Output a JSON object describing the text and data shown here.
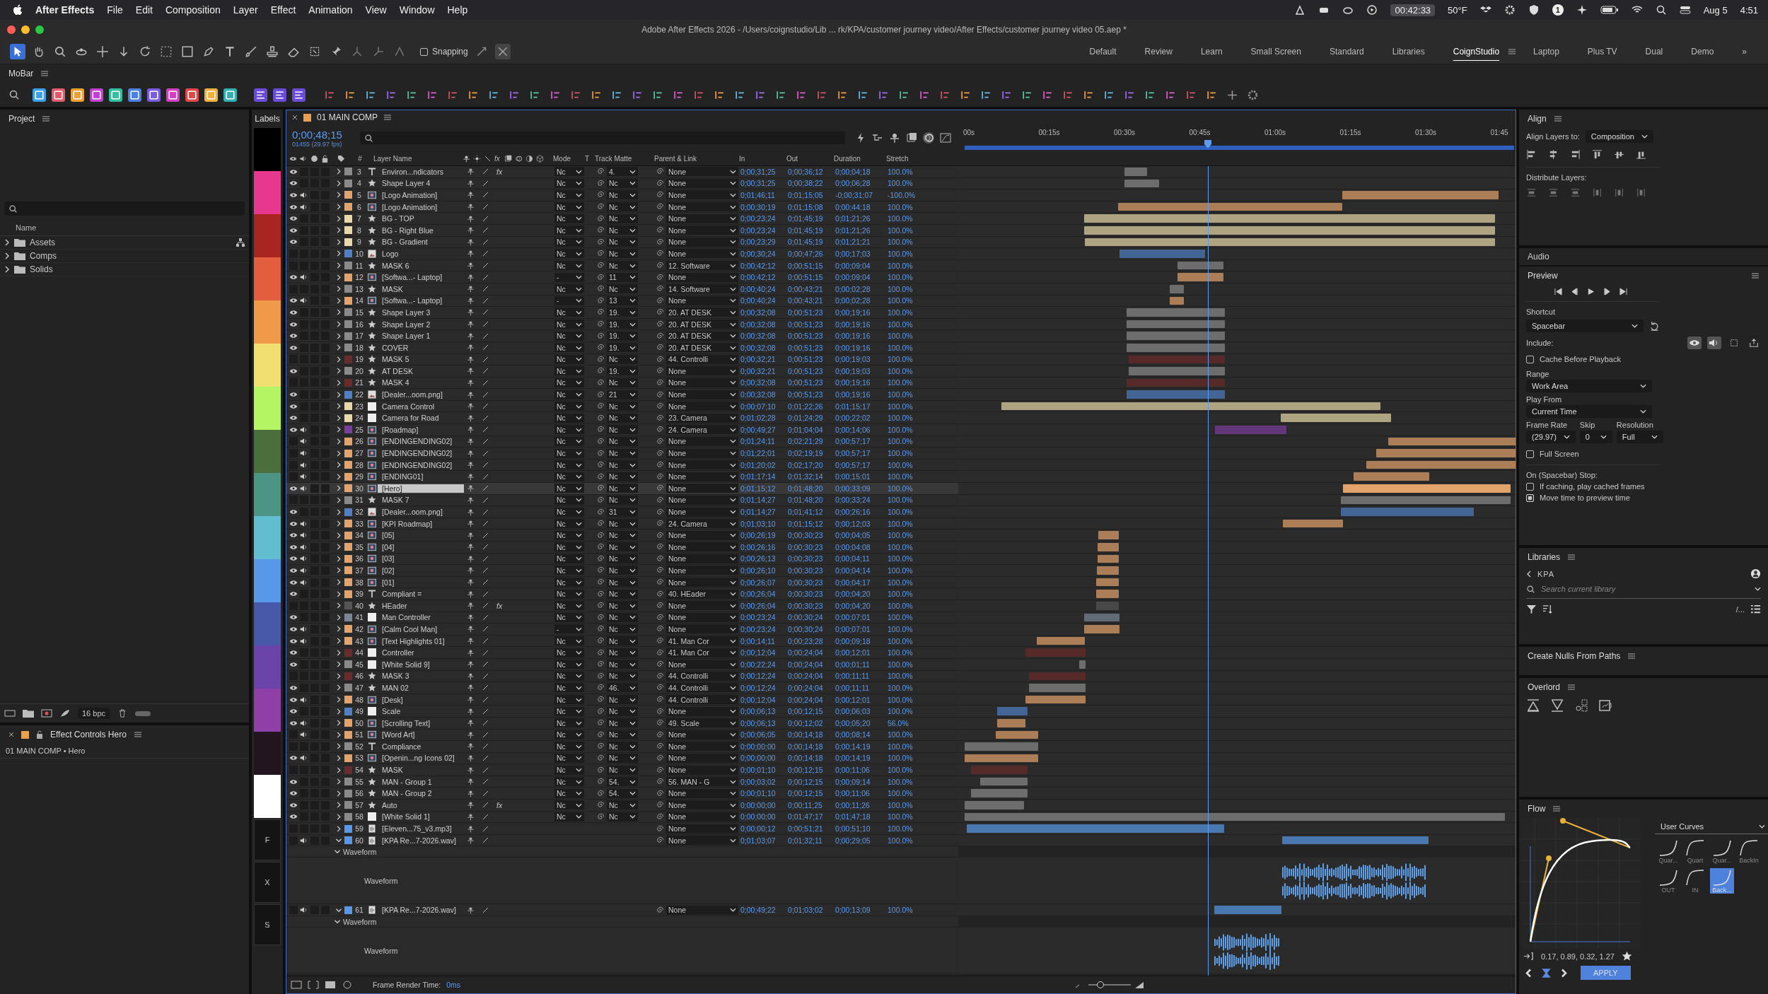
{
  "menubar": {
    "app": "After Effects",
    "items": [
      "File",
      "Edit",
      "Composition",
      "Layer",
      "Effect",
      "Animation",
      "View",
      "Window",
      "Help"
    ],
    "timer": "00:42:33",
    "weather": "50°F",
    "badge": "1",
    "date": "Aug 5",
    "clock": "4:51"
  },
  "window": {
    "title": "Adobe After Effects 2026 - /Users/coignstudio/Lib ... rk/KPA/customer journey video/After Effects/customer journey video 05.aep *"
  },
  "toolbar": {
    "snapping": {
      "label": "Snapping",
      "checked": false
    },
    "workspaces": [
      {
        "label": "Default",
        "selected": false
      },
      {
        "label": "Review",
        "selected": false
      },
      {
        "label": "Learn",
        "selected": false
      },
      {
        "label": "Small Screen",
        "selected": false
      },
      {
        "label": "Standard",
        "selected": false
      },
      {
        "label": "Libraries",
        "selected": false
      },
      {
        "label": "CoignStudio",
        "selected": true
      },
      {
        "label": "Laptop",
        "selected": false
      },
      {
        "label": "Plus TV",
        "selected": false
      },
      {
        "label": "Dual",
        "selected": false
      },
      {
        "label": "Demo",
        "selected": false
      }
    ],
    "more": "»"
  },
  "mobar": {
    "title": "MoBar"
  },
  "project": {
    "title": "Project",
    "column": "Name",
    "folders": [
      {
        "name": "Assets",
        "expanded": false
      },
      {
        "name": "Comps",
        "expanded": false
      },
      {
        "name": "Solids",
        "expanded": false
      }
    ],
    "depth": "16 bpc"
  },
  "effect_controls": {
    "title": "Effect Controls Hero",
    "path": "01 MAIN COMP • Hero"
  },
  "labels": {
    "title": "Labels",
    "swatches": [
      {
        "color": "#000000"
      },
      {
        "color": "#e8378e"
      },
      {
        "color": "#a8261f"
      },
      {
        "color": "#e25e3c"
      },
      {
        "color": "#ef9a48"
      },
      {
        "color": "#f1e06f"
      },
      {
        "color": "#b3f563"
      },
      {
        "color": "#4a6e3c"
      },
      {
        "color": "#4c9484"
      },
      {
        "color": "#63bdd0"
      },
      {
        "color": "#5798e8"
      },
      {
        "color": "#4759a8"
      },
      {
        "color": "#6a44a8"
      },
      {
        "color": "#8e40a8"
      },
      {
        "color": "#221520"
      },
      {
        "color": "#ffffff"
      }
    ],
    "buttons": [
      "F",
      "X",
      "S"
    ]
  },
  "comp": {
    "tab": "01 MAIN COMP",
    "time": "0;00;48;15",
    "frames": "01455 (29.97 fps)",
    "columns": {
      "fx": "fx",
      "num": "#",
      "name": "Layer Name",
      "mode": "Mode",
      "t": "T",
      "matte": "Track Matte",
      "parent": "Parent & Link",
      "in": "In",
      "out": "Out",
      "duration": "Duration",
      "stretch": "Stretch"
    },
    "ruler": [
      "00s",
      "00:15s",
      "00:30s",
      "00:45s",
      "01:00s",
      "01:15s",
      "01:30s",
      "01:45"
    ],
    "layers": [
      {
        "num": "3",
        "kind": "text",
        "name": "Environ...ndicators",
        "color": "#8a8a8a",
        "video": true,
        "audio": false,
        "effects": "fx",
        "mode": "Nc",
        "matte": "4.",
        "parent": "None",
        "in": "0;00;31;25",
        "out": "0;00;36;12",
        "duration": "0;00;04;18",
        "stretch": "100.0%",
        "selected": false,
        "expanded": false
      },
      {
        "num": "4",
        "kind": "shape",
        "name": "Shape Layer 4",
        "color": "#8a8a8a",
        "video": true,
        "audio": false,
        "mode": "Nc",
        "matte": "Nc",
        "parent": "None",
        "in": "0;00;31;25",
        "out": "0;00;38;22",
        "duration": "0;00;06;28",
        "stretch": "100.0%",
        "selected": false,
        "expanded": false
      },
      {
        "num": "5",
        "kind": "precomp",
        "name": "[Logo Animation]",
        "color": "#e3a36b",
        "video": true,
        "audio": true,
        "mode": "Nc",
        "matte": "Nc",
        "parent": "None",
        "in": "0;01;46;11",
        "out": "0;01;15;05",
        "duration": "-0;00;31;07",
        "stretch": "-100.0%",
        "selected": false,
        "expanded": false
      },
      {
        "num": "6",
        "kind": "precomp",
        "name": "[Logo Animation]",
        "color": "#e3a36b",
        "video": true,
        "audio": true,
        "mode": "Nc",
        "matte": "Nc",
        "parent": "None",
        "in": "0;00;30;19",
        "out": "0;01;15;08",
        "duration": "0;00;44;18",
        "stretch": "100.0%",
        "selected": false,
        "expanded": false
      },
      {
        "num": "7",
        "kind": "shape",
        "name": "BG - TOP",
        "color": "#e8d9a6",
        "video": true,
        "audio": false,
        "mode": "Nc",
        "matte": "Nc",
        "parent": "None",
        "in": "0;00;23;24",
        "out": "0;01;45;19",
        "duration": "0;01;21;26",
        "stretch": "100.0%",
        "selected": false,
        "expanded": false
      },
      {
        "num": "8",
        "kind": "shape",
        "name": "BG - Right Blue",
        "color": "#e8d9a6",
        "video": true,
        "audio": false,
        "mode": "Nc",
        "matte": "Nc",
        "parent": "None",
        "in": "0;00;23;24",
        "out": "0;01;45;19",
        "duration": "0;01;21;26",
        "stretch": "100.0%",
        "selected": false,
        "expanded": false
      },
      {
        "num": "9",
        "kind": "shape",
        "name": "BG - Gradient",
        "color": "#e8d9a6",
        "video": true,
        "audio": false,
        "mode": "Nc",
        "matte": "Nc",
        "parent": "None",
        "in": "0;00;23;29",
        "out": "0;01;45;19",
        "duration": "0;01;21;21",
        "stretch": "100.0%",
        "selected": false,
        "expanded": false
      },
      {
        "num": "10",
        "kind": "image",
        "name": "Logo",
        "color": "#4f7fc4",
        "video": false,
        "audio": false,
        "mode": "Nc",
        "matte": "Nc",
        "parent": "None",
        "in": "0;00;30;24",
        "out": "0;00;47;26",
        "duration": "0;00;17;03",
        "stretch": "100.0%",
        "selected": false,
        "expanded": false
      },
      {
        "num": "11",
        "kind": "shape",
        "name": "MASK 6",
        "color": "#8a8a8a",
        "video": false,
        "audio": false,
        "mode": "Nc",
        "matte": "Nc",
        "parent": "12. Software",
        "in": "0;00;42;12",
        "out": "0;00;51;15",
        "duration": "0;00;09;04",
        "stretch": "100.0%",
        "selected": false,
        "expanded": false
      },
      {
        "num": "12",
        "kind": "precomp",
        "name": "[Softwa...- Laptop]",
        "color": "#e3a36b",
        "video": true,
        "audio": true,
        "mode": "-",
        "matte": "11",
        "parent": "None",
        "in": "0;00;42;12",
        "out": "0;00;51;15",
        "duration": "0;00;09;04",
        "stretch": "100.0%",
        "selected": false,
        "expanded": false
      },
      {
        "num": "13",
        "kind": "shape",
        "name": "MASK",
        "color": "#8a8a8a",
        "video": false,
        "audio": false,
        "mode": "Nc",
        "matte": "Nc",
        "parent": "14. Software",
        "in": "0;00;40;24",
        "out": "0;00;43;21",
        "duration": "0;00;02;28",
        "stretch": "100.0%",
        "selected": false,
        "expanded": false
      },
      {
        "num": "14",
        "kind": "precomp",
        "name": "[Softwa...- Laptop]",
        "color": "#e3a36b",
        "video": true,
        "audio": true,
        "mode": "-",
        "matte": "13",
        "parent": "None",
        "in": "0;00;40;24",
        "out": "0;00;43;21",
        "duration": "0;00;02;28",
        "stretch": "100.0%",
        "selected": false,
        "expanded": false
      },
      {
        "num": "15",
        "kind": "shape",
        "name": "Shape Layer 3",
        "color": "#8a8a8a",
        "video": true,
        "audio": false,
        "mode": "Nc",
        "matte": "19.",
        "parent": "20. AT DESK",
        "in": "0;00;32;08",
        "out": "0;00;51;23",
        "duration": "0;00;19;16",
        "stretch": "100.0%",
        "selected": false,
        "expanded": false
      },
      {
        "num": "16",
        "kind": "shape",
        "name": "Shape Layer 2",
        "color": "#8a8a8a",
        "video": true,
        "audio": false,
        "mode": "Nc",
        "matte": "19.",
        "parent": "20. AT DESK",
        "in": "0;00;32;08",
        "out": "0;00;51;23",
        "duration": "0;00;19;16",
        "stretch": "100.0%",
        "selected": false,
        "expanded": false
      },
      {
        "num": "17",
        "kind": "shape",
        "name": "Shape Layer 1",
        "color": "#8a8a8a",
        "video": true,
        "audio": false,
        "mode": "Nc",
        "matte": "19.",
        "parent": "20. AT DESK",
        "in": "0;00;32;08",
        "out": "0;00;51;23",
        "duration": "0;00;19;16",
        "stretch": "100.0%",
        "selected": false,
        "expanded": false
      },
      {
        "num": "18",
        "kind": "shape",
        "name": "COVER",
        "color": "#8a8a8a",
        "video": true,
        "audio": false,
        "mode": "Nc",
        "matte": "19.",
        "parent": "20. AT DESK",
        "in": "0;00;32;08",
        "out": "0;00;51;23",
        "duration": "0;00;19;16",
        "stretch": "100.0%",
        "selected": false,
        "expanded": false
      },
      {
        "num": "19",
        "kind": "shape",
        "name": "MASK 5",
        "color": "#6b2b2b",
        "video": false,
        "audio": false,
        "mode": "Nc",
        "matte": "Nc",
        "parent": "44. Controlli",
        "in": "0;00;32;21",
        "out": "0;00;51;23",
        "duration": "0;00;19;03",
        "stretch": "100.0%",
        "selected": false,
        "expanded": false
      },
      {
        "num": "20",
        "kind": "shape",
        "name": "AT DESK",
        "color": "#8a8a8a",
        "video": true,
        "audio": false,
        "mode": "Nc",
        "matte": "19.",
        "parent": "None",
        "in": "0;00;32;21",
        "out": "0;00;51;23",
        "duration": "0;00;19;03",
        "stretch": "100.0%",
        "selected": false,
        "expanded": false
      },
      {
        "num": "21",
        "kind": "shape",
        "name": "MASK 4",
        "color": "#6b2b2b",
        "video": false,
        "audio": false,
        "mode": "Nc",
        "matte": "Nc",
        "parent": "None",
        "in": "0;00;32;08",
        "out": "0;00;51;23",
        "duration": "0;00;19;16",
        "stretch": "100.0%",
        "selected": false,
        "expanded": false
      },
      {
        "num": "22",
        "kind": "image",
        "name": "[Dealer...oom.png]",
        "color": "#4f7fc4",
        "video": true,
        "audio": false,
        "mode": "Nc",
        "matte": "21",
        "parent": "None",
        "in": "0;00;32;08",
        "out": "0;00;51;23",
        "duration": "0;00;19;16",
        "stretch": "100.0%",
        "selected": false,
        "expanded": false
      },
      {
        "num": "23",
        "kind": "solid",
        "name": "Camera Control",
        "color": "#e8d9a6",
        "video": true,
        "audio": false,
        "mode": "Nc",
        "matte": "Nc",
        "parent": "None",
        "in": "0;00;07;10",
        "out": "0;01;22;26",
        "duration": "0;01;15;17",
        "stretch": "100.0%",
        "selected": false,
        "expanded": false
      },
      {
        "num": "24",
        "kind": "solid",
        "name": "Camera for Road",
        "color": "#e8d9a6",
        "video": true,
        "audio": false,
        "mode": "Nc",
        "matte": "Nc",
        "parent": "23. Camera",
        "in": "0;01;02;28",
        "out": "0;01;24;29",
        "duration": "0;00;22;02",
        "stretch": "100.0%",
        "selected": false,
        "expanded": false
      },
      {
        "num": "25",
        "kind": "precomp",
        "name": "[Roadmap]",
        "color": "#7a3f9e",
        "video": true,
        "audio": true,
        "mode": "Nc",
        "matte": "Nc",
        "parent": "24. Camera",
        "in": "0;00;49;27",
        "out": "0;01;04;04",
        "duration": "0;00;14;06",
        "stretch": "100.0%",
        "selected": false,
        "expanded": false
      },
      {
        "num": "26",
        "kind": "precomp",
        "name": "[ENDINGENDING02]",
        "color": "#e3a36b",
        "video": false,
        "audio": true,
        "mode": "Nc",
        "matte": "Nc",
        "parent": "None",
        "in": "0;01;24;11",
        "out": "0;02;21;29",
        "duration": "0;00;57;17",
        "stretch": "100.0%",
        "selected": false,
        "expanded": false
      },
      {
        "num": "27",
        "kind": "precomp",
        "name": "[ENDINGENDING02]",
        "color": "#e3a36b",
        "video": false,
        "audio": true,
        "mode": "Nc",
        "matte": "Nc",
        "parent": "None",
        "in": "0;01;22;01",
        "out": "0;02;19;19",
        "duration": "0;00;57;17",
        "stretch": "100.0%",
        "selected": false,
        "expanded": false
      },
      {
        "num": "28",
        "kind": "precomp",
        "name": "[ENDINGENDING02]",
        "color": "#e3a36b",
        "video": false,
        "audio": true,
        "mode": "Nc",
        "matte": "Nc",
        "parent": "None",
        "in": "0;01;20;02",
        "out": "0;02;17;20",
        "duration": "0;00;57;17",
        "stretch": "100.0%",
        "selected": false,
        "expanded": false
      },
      {
        "num": "29",
        "kind": "precomp",
        "name": "[ENDING01]",
        "color": "#e3a36b",
        "video": false,
        "audio": true,
        "mode": "Nc",
        "matte": "Nc",
        "parent": "None",
        "in": "0;01;17;14",
        "out": "0;01;32;14",
        "duration": "0;00;15;01",
        "stretch": "100.0%",
        "selected": false,
        "expanded": false
      },
      {
        "num": "30",
        "kind": "precomp",
        "name": "[Hero]",
        "color": "#e3a36b",
        "video": true,
        "audio": true,
        "mode": "Nc",
        "matte": "Nc",
        "parent": "None",
        "in": "0;01;15;12",
        "out": "0;01;48;20",
        "duration": "0;00;33;09",
        "stretch": "100.0%",
        "selected": true,
        "expanded": false
      },
      {
        "num": "31",
        "kind": "shape",
        "name": "MASK 7",
        "color": "#8a8a8a",
        "video": false,
        "audio": false,
        "mode": "Nc",
        "matte": "Nc",
        "parent": "None",
        "in": "0;01;14;27",
        "out": "0;01;48;20",
        "duration": "0;00;33;24",
        "stretch": "100.0%",
        "selected": false,
        "expanded": false
      },
      {
        "num": "32",
        "kind": "image",
        "name": "[Dealer...oom.png]",
        "color": "#4f7fc4",
        "video": true,
        "audio": false,
        "mode": "Nc",
        "matte": "31",
        "parent": "None",
        "in": "0;01;14;27",
        "out": "0;01;41;12",
        "duration": "0;00;26;16",
        "stretch": "100.0%",
        "selected": false,
        "expanded": false
      },
      {
        "num": "33",
        "kind": "precomp",
        "name": "[KPI Roadmap]",
        "color": "#e3a36b",
        "video": true,
        "audio": true,
        "mode": "Nc",
        "matte": "Nc",
        "parent": "24. Camera",
        "in": "0;01;03;10",
        "out": "0;01;15;12",
        "duration": "0;00;12;03",
        "stretch": "100.0%",
        "selected": false,
        "expanded": false
      },
      {
        "num": "34",
        "kind": "precomp",
        "name": "[05]",
        "color": "#e3a36b",
        "video": true,
        "audio": true,
        "mode": "Nc",
        "matte": "Nc",
        "parent": "None",
        "in": "0;00;26;19",
        "out": "0;00;30;23",
        "duration": "0;00;04;05",
        "stretch": "100.0%",
        "selected": false,
        "expanded": false
      },
      {
        "num": "35",
        "kind": "precomp",
        "name": "[04]",
        "color": "#e3a36b",
        "video": true,
        "audio": true,
        "mode": "Nc",
        "matte": "Nc",
        "parent": "None",
        "in": "0;00;26;16",
        "out": "0;00;30;23",
        "duration": "0;00;04;08",
        "stretch": "100.0%",
        "selected": false,
        "expanded": false
      },
      {
        "num": "36",
        "kind": "precomp",
        "name": "[03]",
        "color": "#e3a36b",
        "video": true,
        "audio": true,
        "mode": "Nc",
        "matte": "Nc",
        "parent": "None",
        "in": "0;00;26;13",
        "out": "0;00;30;23",
        "duration": "0;00;04;11",
        "stretch": "100.0%",
        "selected": false,
        "expanded": false
      },
      {
        "num": "37",
        "kind": "precomp",
        "name": "[02]",
        "color": "#e3a36b",
        "video": true,
        "audio": true,
        "mode": "Nc",
        "matte": "Nc",
        "parent": "None",
        "in": "0;00;26;10",
        "out": "0;00;30;23",
        "duration": "0;00;04;14",
        "stretch": "100.0%",
        "selected": false,
        "expanded": false
      },
      {
        "num": "38",
        "kind": "precomp",
        "name": "[01]",
        "color": "#e3a36b",
        "video": true,
        "audio": true,
        "mode": "Nc",
        "matte": "Nc",
        "parent": "None",
        "in": "0;00;26;07",
        "out": "0;00;30;23",
        "duration": "0;00;04;17",
        "stretch": "100.0%",
        "selected": false,
        "expanded": false
      },
      {
        "num": "39",
        "kind": "text",
        "name": "Compliant =",
        "color": "#e3a36b",
        "video": true,
        "audio": false,
        "mode": "Nc",
        "matte": "Nc",
        "parent": "40. HEader",
        "in": "0;00;26;04",
        "out": "0;00;30;23",
        "duration": "0;00;04;20",
        "stretch": "100.0%",
        "selected": false,
        "expanded": false
      },
      {
        "num": "40",
        "kind": "shape",
        "name": "HEader",
        "color": "#555555",
        "video": false,
        "audio": false,
        "effects": "fx",
        "mode": "Nc",
        "matte": "Nc",
        "parent": "None",
        "in": "0;00;26;04",
        "out": "0;00;30;23",
        "duration": "0;00;04;20",
        "stretch": "100.0%",
        "selected": false,
        "expanded": false
      },
      {
        "num": "41",
        "kind": "solid",
        "name": "Man Controller",
        "color": "#7a8799",
        "video": true,
        "audio": false,
        "mode": "Nc",
        "matte": "Nc",
        "parent": "None",
        "in": "0;00;23;24",
        "out": "0;00;30;24",
        "duration": "0;00;07;01",
        "stretch": "100.0%",
        "selected": false,
        "expanded": false
      },
      {
        "num": "42",
        "kind": "precomp",
        "name": "[Calm Cool Man]",
        "color": "#e3a36b",
        "video": true,
        "audio": true,
        "mode": "-",
        "matte": "Nc",
        "parent": "None",
        "in": "0;00;23;24",
        "out": "0;00;30;24",
        "duration": "0;00;07;01",
        "stretch": "100.0%",
        "selected": false,
        "expanded": false
      },
      {
        "num": "43",
        "kind": "precomp",
        "name": "[Text Highlights 01]",
        "color": "#e3a36b",
        "video": true,
        "audio": true,
        "mode": "Nc",
        "matte": "Nc",
        "parent": "41. Man Cor",
        "in": "0;00;14;11",
        "out": "0;00;23;28",
        "duration": "0;00;09;18",
        "stretch": "100.0%",
        "selected": false,
        "expanded": false
      },
      {
        "num": "44",
        "kind": "solid",
        "name": "Controller",
        "color": "#6b2b2b",
        "video": true,
        "audio": false,
        "mode": "Nc",
        "matte": "Nc",
        "parent": "41. Man Cor",
        "in": "0;00;12;04",
        "out": "0;00;24;04",
        "duration": "0;00;12;01",
        "stretch": "100.0%",
        "selected": false,
        "expanded": false
      },
      {
        "num": "45",
        "kind": "solid",
        "name": "[White Solid 9]",
        "color": "#8a8a8a",
        "video": true,
        "audio": false,
        "mode": "Nc",
        "matte": "Nc",
        "parent": "None",
        "in": "0;00;22;24",
        "out": "0;00;24;04",
        "duration": "0;00;01;11",
        "stretch": "100.0%",
        "selected": false,
        "expanded": false
      },
      {
        "num": "46",
        "kind": "shape",
        "name": "MASK 3",
        "color": "#6b2b2b",
        "video": false,
        "audio": false,
        "mode": "Nc",
        "matte": "Nc",
        "parent": "44. Controlli",
        "in": "0;00;12;24",
        "out": "0;00;24;04",
        "duration": "0;00;11;11",
        "stretch": "100.0%",
        "selected": false,
        "expanded": false
      },
      {
        "num": "47",
        "kind": "shape",
        "name": "MAN 02",
        "color": "#8a8a8a",
        "video": true,
        "audio": false,
        "mode": "Nc",
        "matte": "46.",
        "parent": "44. Controlli",
        "in": "0;00;12;24",
        "out": "0;00;24;04",
        "duration": "0;00;11;11",
        "stretch": "100.0%",
        "selected": false,
        "expanded": false
      },
      {
        "num": "48",
        "kind": "precomp",
        "name": "[Desk]",
        "color": "#e3a36b",
        "video": true,
        "audio": true,
        "mode": "Nc",
        "matte": "Nc",
        "parent": "44. Controlli",
        "in": "0;00;12;04",
        "out": "0;00;24;04",
        "duration": "0;00;12;01",
        "stretch": "100.0%",
        "selected": false,
        "expanded": false
      },
      {
        "num": "49",
        "kind": "solid",
        "name": "Scale",
        "color": "#4f7fc4",
        "video": true,
        "audio": false,
        "mode": "Nc",
        "matte": "Nc",
        "parent": "None",
        "in": "0;00;06;13",
        "out": "0;00;12;15",
        "duration": "0;00;06;03",
        "stretch": "100.0%",
        "selected": false,
        "expanded": false
      },
      {
        "num": "50",
        "kind": "precomp",
        "name": "[Scrolling Text]",
        "color": "#e3a36b",
        "video": true,
        "audio": true,
        "mode": "Nc",
        "matte": "Nc",
        "parent": "49. Scale",
        "in": "0;00;06;13",
        "out": "0;00;12;02",
        "duration": "0;00;05;20",
        "stretch": "56.0%",
        "selected": false,
        "expanded": false
      },
      {
        "num": "51",
        "kind": "precomp",
        "name": "[Word Art]",
        "color": "#e3a36b",
        "video": false,
        "audio": true,
        "mode": "Nc",
        "matte": "Nc",
        "parent": "None",
        "in": "0;00;06;05",
        "out": "0;00;14;18",
        "duration": "0;00;08;14",
        "stretch": "100.0%",
        "selected": false,
        "expanded": false
      },
      {
        "num": "52",
        "kind": "text",
        "name": "Compliance",
        "color": "#8a8a8a",
        "video": false,
        "audio": false,
        "mode": "Nc",
        "matte": "Nc",
        "parent": "None",
        "in": "0;00;00;00",
        "out": "0;00;14;18",
        "duration": "0;00;14;19",
        "stretch": "100.0%",
        "selected": false,
        "expanded": false
      },
      {
        "num": "53",
        "kind": "precomp",
        "name": "[Openin...ng Icons 02]",
        "color": "#e3a36b",
        "video": true,
        "audio": true,
        "mode": "Nc",
        "matte": "Nc",
        "parent": "None",
        "in": "0;00;00;00",
        "out": "0;00;14;18",
        "duration": "0;00;14;19",
        "stretch": "100.0%",
        "selected": false,
        "expanded": false
      },
      {
        "num": "54",
        "kind": "shape",
        "name": "MASK",
        "color": "#6b2b2b",
        "video": false,
        "audio": false,
        "mode": "Nc",
        "matte": "Nc",
        "parent": "None",
        "in": "0;00;01;10",
        "out": "0;00;12;15",
        "duration": "0;00;11;06",
        "stretch": "100.0%",
        "selected": false,
        "expanded": false
      },
      {
        "num": "55",
        "kind": "shape",
        "name": "MAN - Group 1",
        "color": "#8a8a8a",
        "video": true,
        "audio": false,
        "mode": "Nc",
        "matte": "54.",
        "parent": "56. MAN - G",
        "in": "0;00;03;02",
        "out": "0;00;12;15",
        "duration": "0;00;09;14",
        "stretch": "100.0%",
        "selected": false,
        "expanded": false
      },
      {
        "num": "56",
        "kind": "shape",
        "name": "MAN - Group 2",
        "color": "#8a8a8a",
        "video": true,
        "audio": false,
        "mode": "Nc",
        "matte": "54.",
        "parent": "None",
        "in": "0;00;01;10",
        "out": "0;00;12;15",
        "duration": "0;00;11;06",
        "stretch": "100.0%",
        "selected": false,
        "expanded": false
      },
      {
        "num": "57",
        "kind": "shape",
        "name": "Auto",
        "color": "#8a8a8a",
        "video": true,
        "audio": false,
        "effects": "fx",
        "mode": "Nc",
        "matte": "Nc",
        "parent": "None",
        "in": "0;00;00;00",
        "out": "0;00;11;25",
        "duration": "0;00;11;26",
        "stretch": "100.0%",
        "selected": false,
        "expanded": false
      },
      {
        "num": "58",
        "kind": "solid",
        "name": "[White Solid 1]",
        "color": "#8a8a8a",
        "video": true,
        "audio": false,
        "mode": "Nc",
        "matte": "Nc",
        "parent": "None",
        "in": "0;00;00;00",
        "out": "0;01;47;17",
        "duration": "0;01;47;18",
        "stretch": "100.0%",
        "selected": false,
        "expanded": false
      },
      {
        "num": "59",
        "kind": "audio",
        "name": "[Eleven...75_v3.mp3]",
        "color": "#5798e8",
        "video": false,
        "audio": false,
        "parent": "None",
        "in": "0;00;00;12",
        "out": "0;00;51;21",
        "duration": "0;00;51;10",
        "stretch": "100.0%",
        "selected": false,
        "expanded": false
      },
      {
        "num": "60",
        "kind": "audio",
        "name": "[KPA Re...7-2026.wav]",
        "color": "#5798e8",
        "video": false,
        "audio": true,
        "parent": "None",
        "in": "0;01;03;07",
        "out": "0;01;32;11",
        "duration": "0;00;29;05",
        "stretch": "100.0%",
        "selected": false,
        "expanded": true,
        "group": "Waveform",
        "property": "Waveform"
      },
      {
        "num": "61",
        "kind": "audio",
        "name": "[KPA Re...7-2026.wav]",
        "color": "#5798e8",
        "video": false,
        "audio": true,
        "parent": "None",
        "in": "0;00;49;22",
        "out": "0;01;03;02",
        "duration": "0;00;13;09",
        "stretch": "100.0%",
        "selected": false,
        "expanded": true,
        "group": "Waveform",
        "property": "Waveform"
      }
    ],
    "footer": {
      "label": "Frame Render Time:",
      "value": "0ms"
    }
  },
  "align": {
    "title": "Align",
    "align_to_label": "Align Layers to:",
    "align_to": "Composition",
    "distribute": "Distribute Layers:"
  },
  "preview": {
    "tabs": [
      "Audio",
      "Preview"
    ],
    "shortcut_label": "Shortcut",
    "shortcut": "Spacebar",
    "include": "Include:",
    "cache": {
      "label": "Cache Before Playback",
      "checked": false
    },
    "range_label": "Range",
    "range": "Work Area",
    "play_from_label": "Play From",
    "play_from": "Current Time",
    "frame_rate_label": "Frame Rate",
    "frame_rate": "(29.97)",
    "skip_label": "Skip",
    "skip": "0",
    "resolution_label": "Resolution",
    "resolution": "Full",
    "full_screen": {
      "label": "Full Screen",
      "checked": false
    },
    "stop_label": "On (Spacebar) Stop:",
    "stop_options": [
      {
        "label": "If caching, play cached frames",
        "checked": false
      },
      {
        "label": "Move time to preview time",
        "checked": true
      }
    ]
  },
  "libraries": {
    "title": "Libraries",
    "library": "KPA",
    "placeholder": "Search current library",
    "more": "/..."
  },
  "nulls": {
    "title": "Create Nulls From Paths"
  },
  "overlord": {
    "title": "Overlord"
  },
  "flow": {
    "title": "Flow",
    "preset_group": "User Curves",
    "presets": [
      {
        "label": "Quar...",
        "selected": false
      },
      {
        "label": "Quart",
        "selected": false
      },
      {
        "label": "Quar...",
        "selected": false
      },
      {
        "label": "BackIn",
        "selected": false
      },
      {
        "label": "OUT",
        "selected": false
      },
      {
        "label": "IN",
        "selected": false
      },
      {
        "label": "Back...",
        "selected": true
      }
    ],
    "values": "0.17, 0.89, 0.32, 1.27",
    "apply": "APPLY"
  }
}
